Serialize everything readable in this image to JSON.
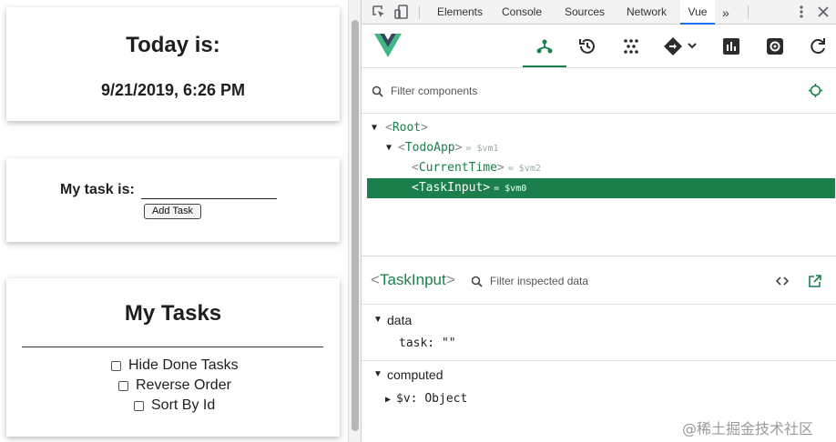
{
  "app": {
    "time_card": {
      "title": "Today is:",
      "value": "9/21/2019, 6:26 PM"
    },
    "task_card": {
      "label": "My task is:",
      "input_value": "",
      "add_button": "Add Task"
    },
    "list_card": {
      "title": "My Tasks",
      "options": [
        {
          "label": "Hide Done Tasks",
          "checked": false
        },
        {
          "label": "Reverse Order",
          "checked": false
        },
        {
          "label": "Sort By Id",
          "checked": false
        }
      ]
    }
  },
  "devtools": {
    "tabs": [
      "Elements",
      "Console",
      "Sources",
      "Network",
      "Vue"
    ],
    "more_tabs": "»",
    "active_tab": "Vue",
    "vue_toolbar": {
      "active": "components",
      "icons": [
        "components-icon",
        "history-icon",
        "vuex-icon",
        "router-icon",
        "performance-icon",
        "settings-icon",
        "refresh-icon"
      ]
    },
    "component_filter": {
      "placeholder": "Filter components"
    },
    "tree": [
      {
        "name": "Root",
        "vm": ""
      },
      {
        "name": "TodoApp",
        "vm": "= $vm1"
      },
      {
        "name": "CurrentTime",
        "vm": "= $vm2"
      },
      {
        "name": "TaskInput",
        "vm": "= $vm0",
        "selected": true
      }
    ],
    "inspector": {
      "component": "TaskInput",
      "filter_placeholder": "Filter inspected data",
      "sections": [
        {
          "label": "data",
          "props": [
            {
              "key": "task:",
              "value": "\"\""
            }
          ]
        },
        {
          "label": "computed",
          "props": [
            {
              "key": "$v:",
              "value": "Object"
            }
          ]
        }
      ]
    },
    "colors": {
      "vue_green": "#1a7f4b",
      "selected_row": "#1a7f4b",
      "tab_underline": "#1a73e8"
    }
  },
  "watermark": "@稀土掘金技术社区"
}
